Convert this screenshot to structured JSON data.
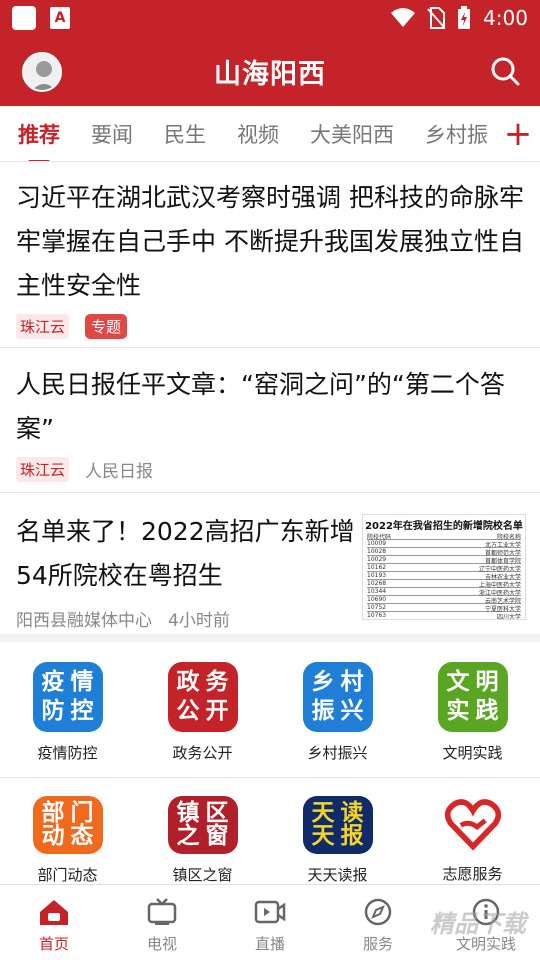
{
  "status_bar": {
    "time": "4:00",
    "icons": [
      "app-square-icon",
      "app-a-icon",
      "wifi-icon",
      "no-sim-icon",
      "battery-icon"
    ],
    "app_a_label": "A"
  },
  "header": {
    "title": "山海阳西",
    "bg_color": "#c4232a"
  },
  "tabs": [
    "推荐",
    "要闻",
    "民生",
    "视频",
    "大美阳西",
    "乡村振"
  ],
  "tabs_plus": "+",
  "news": [
    {
      "title": "习近平在湖北武汉考察时强调 把科技的命脉牢牢掌握在自己手中 不断提升我国发展独立性自主性安全性",
      "source": "珠江云",
      "tag": "专题"
    },
    {
      "title": "人民日报任平文章：“窑洞之问”的“第二个答案”",
      "source": "珠江云",
      "author": "人民日报"
    },
    {
      "title": "名单来了！2022高招广东新增54所院校在粤招生",
      "publisher": "阳西县融媒体中心",
      "time": "4小时前",
      "thumb_title": "2022年在我省招生的新增院校名单",
      "thumb_cols": [
        "院校代码",
        "院校名称"
      ],
      "thumb_rows": [
        [
          "10009",
          "北方工业大学"
        ],
        [
          "10028",
          "首都师范大学"
        ],
        [
          "10029",
          "首都体育学院"
        ],
        [
          "10162",
          "辽宁中医药大学"
        ],
        [
          "10193",
          "吉林农业大学"
        ],
        [
          "10268",
          "上海中医药大学"
        ],
        [
          "10344",
          "浙江中医药大学"
        ],
        [
          "10690",
          "云南艺术学院"
        ],
        [
          "10752",
          "宁夏医科大学"
        ],
        [
          "10763",
          "四川大学"
        ]
      ]
    }
  ],
  "services_row1": [
    {
      "label": "疫情防控",
      "icon_chars": [
        "疫",
        "情",
        "防",
        "控"
      ],
      "color": "#1f7fd6"
    },
    {
      "label": "政务公开",
      "icon_chars": [
        "政",
        "务",
        "公",
        "开"
      ],
      "color": "#c4232a"
    },
    {
      "label": "乡村振兴",
      "icon_chars": [
        "乡",
        "村",
        "振",
        "兴"
      ],
      "color": "#1f7fd6"
    },
    {
      "label": "文明实践",
      "icon_chars": [
        "文",
        "明",
        "实",
        "践"
      ],
      "color": "#5aa521"
    }
  ],
  "services_row2": [
    {
      "label": "部门动态",
      "icon_chars": [
        "部",
        "门",
        "动",
        "态"
      ],
      "color": "#f06a1e"
    },
    {
      "label": "镇区之窗",
      "icon_chars": [
        "镇",
        "区",
        "之",
        "窗"
      ],
      "color": "#b1202a"
    },
    {
      "label": "天天读报",
      "icon_chars": [
        "天",
        "读",
        "天",
        "报"
      ],
      "color": "#102a6a"
    },
    {
      "label": "志愿服务",
      "icon_chars": [],
      "color": "#d62828"
    }
  ],
  "bottom_nav": [
    {
      "label": "首页",
      "icon": "home-icon",
      "active": true
    },
    {
      "label": "电视",
      "icon": "tv-icon",
      "active": false
    },
    {
      "label": "直播",
      "icon": "live-video-icon",
      "active": false
    },
    {
      "label": "服务",
      "icon": "compass-icon",
      "active": false
    },
    {
      "label": "文明实践",
      "icon": "info-icon",
      "active": false
    }
  ],
  "watermark": "精品下载"
}
